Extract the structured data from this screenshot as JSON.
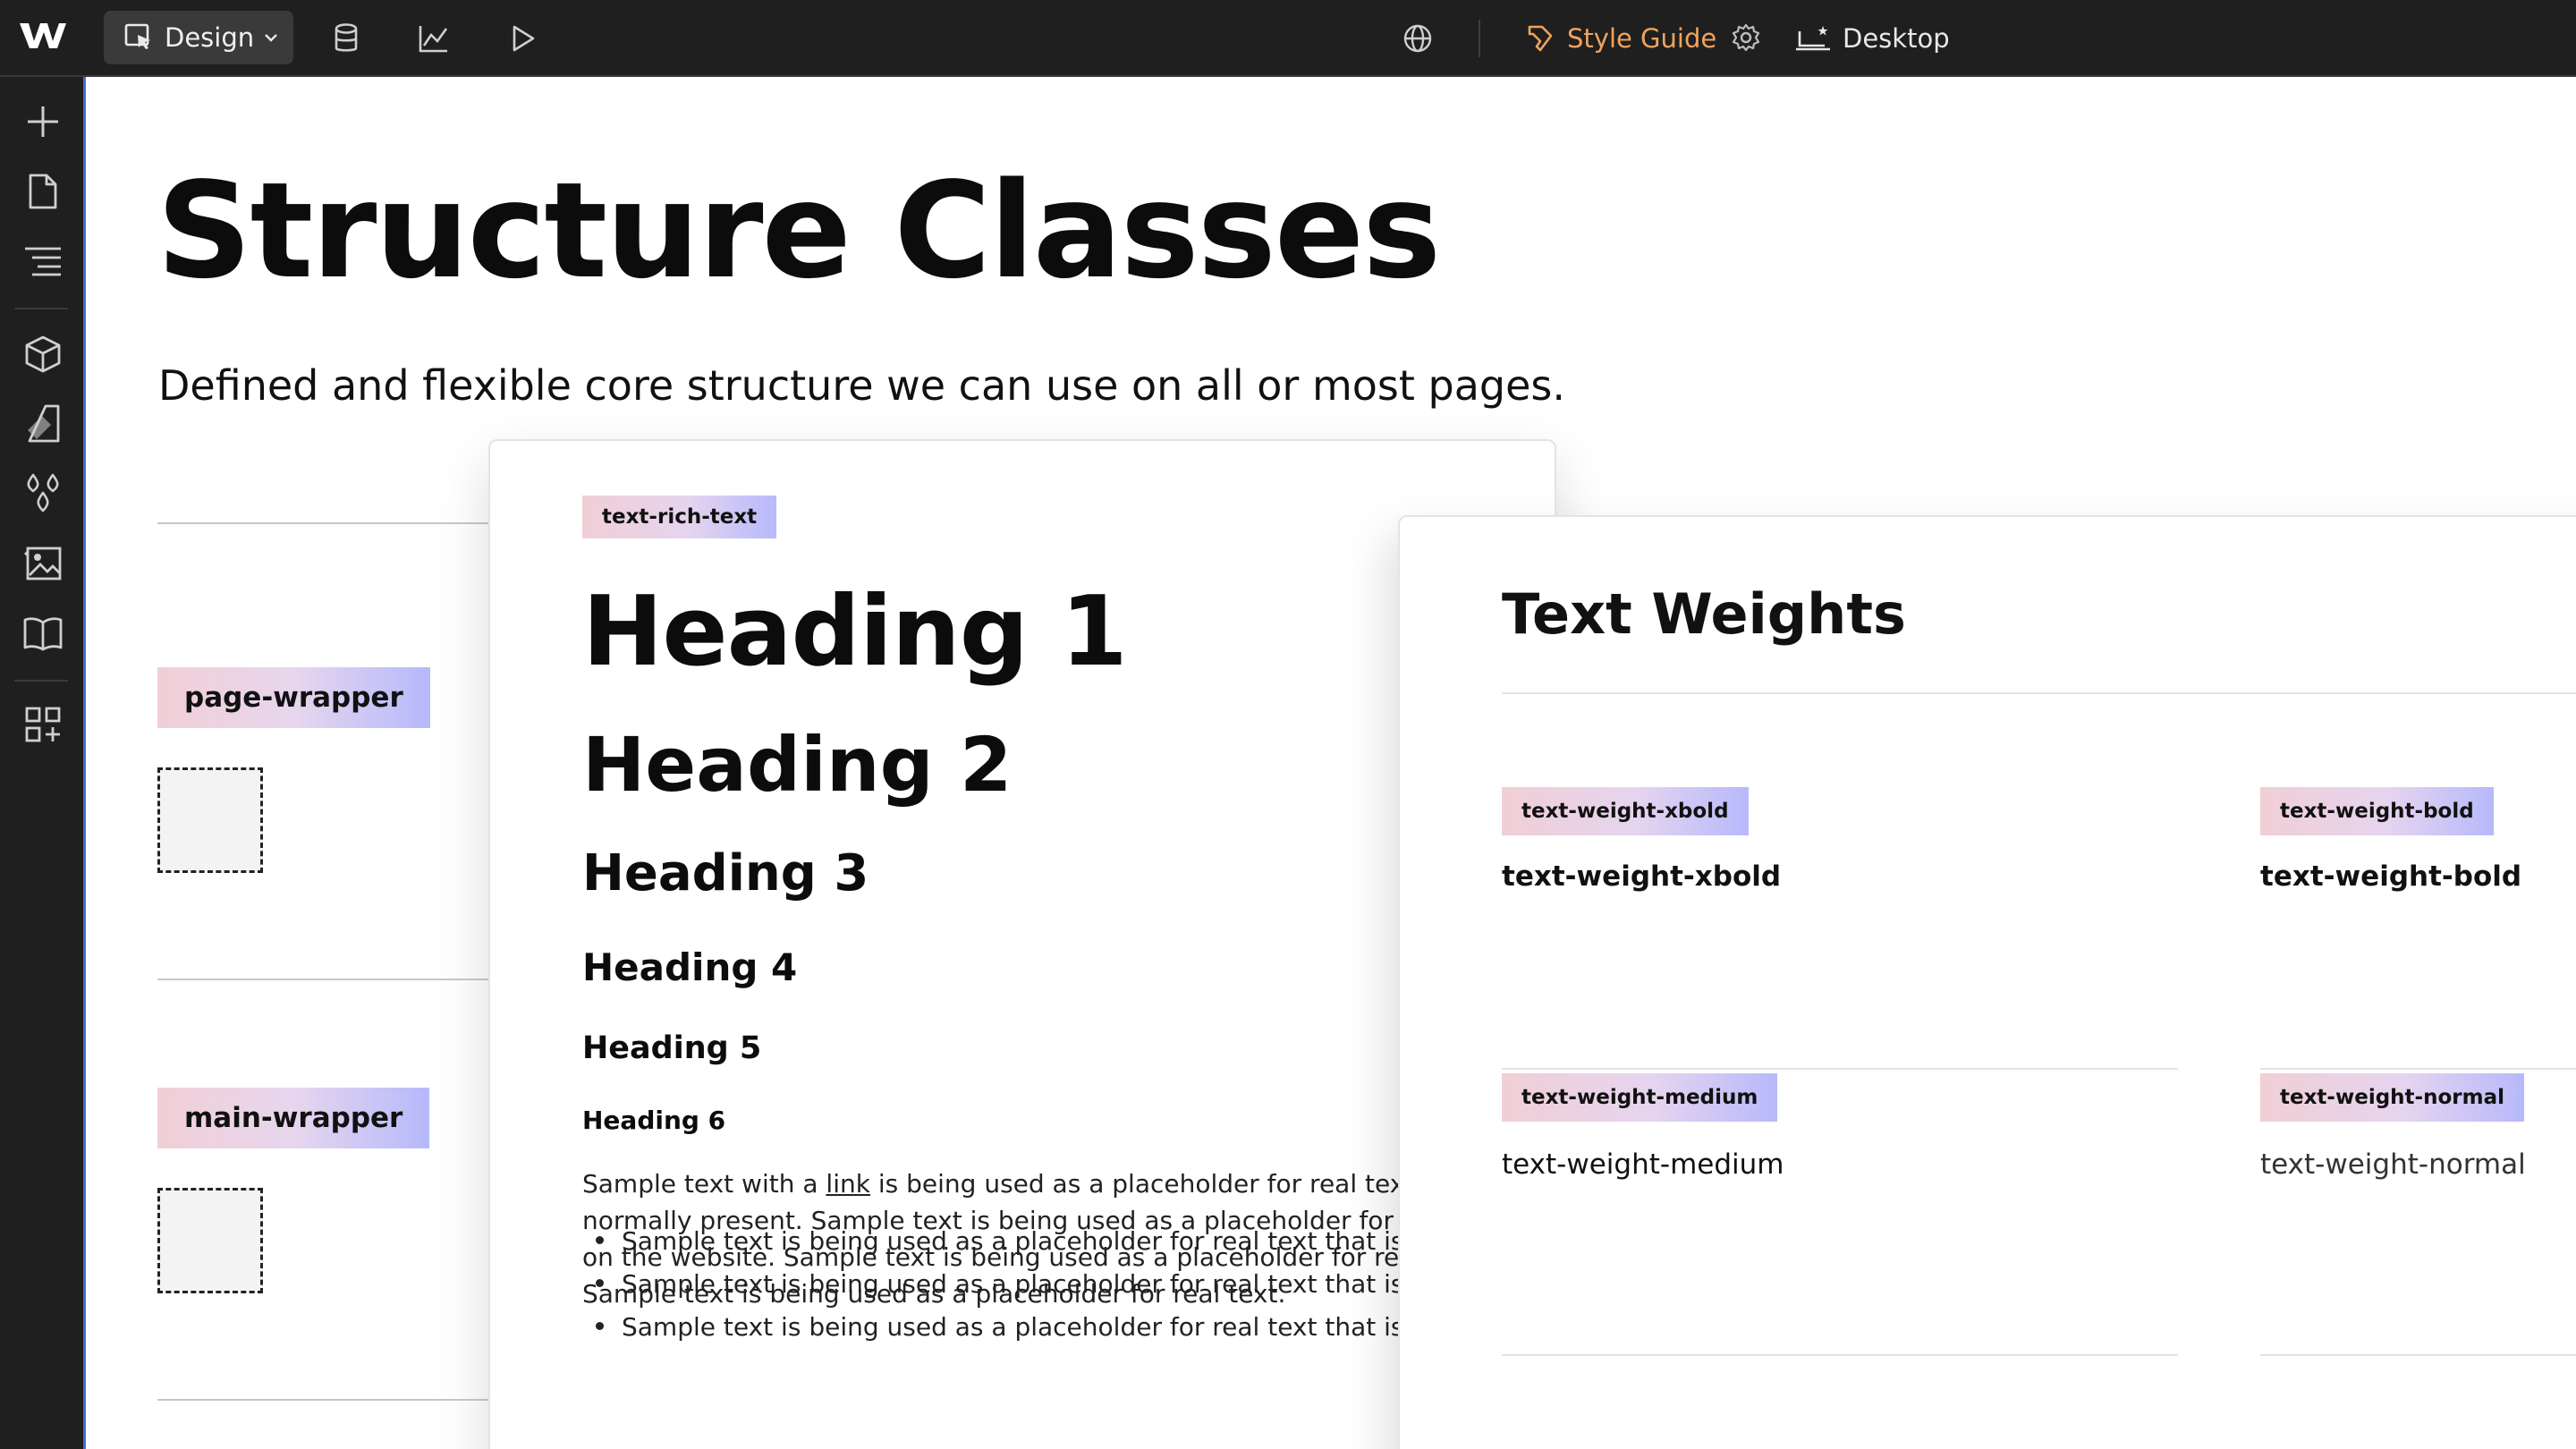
{
  "toolbar": {
    "design_label": "Design",
    "style_guide_label": "Style Guide",
    "device_label": "Desktop",
    "accent_color": "#f0a35e",
    "icons": [
      "webflow-logo-icon",
      "cursor-mode-icon",
      "chevron-down-icon",
      "cms-database-icon",
      "analytics-chart-icon",
      "preview-play-icon",
      "globe-icon",
      "style-guide-icon",
      "gear-icon",
      "desktop-breakpoint-icon"
    ]
  },
  "sidebar": {
    "accent_color": "#3d6fd9",
    "items": [
      {
        "icon": "plus-icon"
      },
      {
        "icon": "page-icon"
      },
      {
        "icon": "navigator-icon"
      },
      {
        "icon": "components-cube-icon"
      },
      {
        "icon": "style-selector-icon"
      },
      {
        "icon": "color-drops-icon"
      },
      {
        "icon": "assets-image-icon"
      },
      {
        "icon": "book-icon"
      },
      {
        "icon": "apps-icon"
      }
    ]
  },
  "page": {
    "title": "Structure Classes",
    "subtitle": "Defined and flexible core structure we can use on all or most pages.",
    "classes": [
      {
        "name": "page-wrapper"
      },
      {
        "name": "main-wrapper"
      }
    ]
  },
  "rich_text_card": {
    "tag": "text-rich-text",
    "heading1": "Heading 1",
    "heading2": "Heading 2",
    "heading3": "Heading 3",
    "heading4": "Heading 4",
    "heading5": "Heading 5",
    "heading6": "Heading 6",
    "para_start": "Sample text with a ",
    "para_link": "link",
    "para_end": " is being used as a placeholder for real text that is normally present. Sample text is being used as a placeholder for real text on the website. Sample text is being used as a placeholder for real text. Sample text is being used as a placeholder for real text.",
    "bullets": [
      "Sample text is being used as a placeholder for real text that is normally present.",
      "Sample text is being used as a placeholder for real text that is normally present.",
      "Sample text is being used as a placeholder for real text that is normally present."
    ]
  },
  "weights_card": {
    "title": "Text Weights",
    "items": [
      {
        "tag": "text-weight-xbold",
        "sample": "text-weight-xbold"
      },
      {
        "tag": "text-weight-bold",
        "sample": "text-weight-bold"
      },
      {
        "tag": "text-weight-medium",
        "sample": "text-weight-medium"
      },
      {
        "tag": "text-weight-normal",
        "sample": "text-weight-normal"
      }
    ]
  }
}
